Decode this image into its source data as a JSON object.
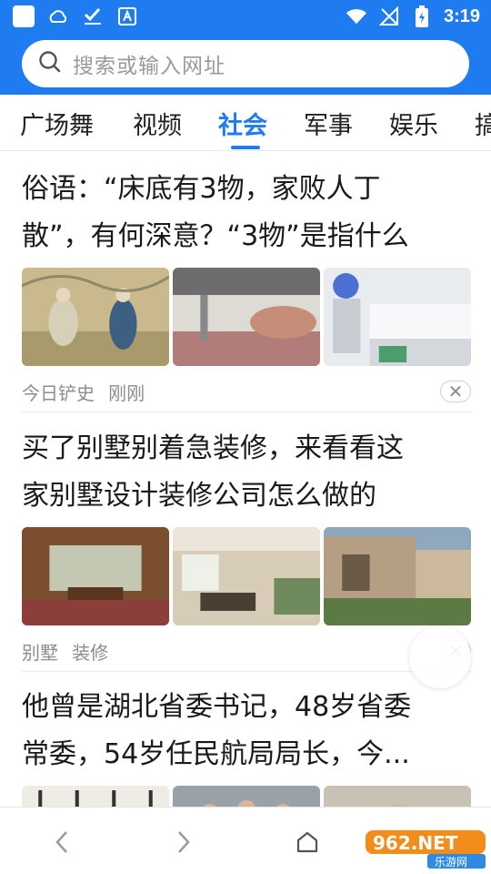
{
  "status_bar": {
    "time": "3:19"
  },
  "search": {
    "placeholder": "搜索或输入网址"
  },
  "tabs": [
    "广场舞",
    "视频",
    "社会",
    "军事",
    "娱乐",
    "搞"
  ],
  "active_tab": "社会",
  "articles": [
    {
      "title_line1": "俗语：“床底有3物，家败人丁",
      "title_line2": "散”，有何深意？“3物”是指什么",
      "source": "今日铲史",
      "time": "刚刚"
    },
    {
      "title_line1": "买了别墅别着急装修，来看看这",
      "title_line2": "家别墅设计装修公司怎么做的",
      "source": "别墅",
      "time": "装修"
    },
    {
      "title_line1": "他曾是湖北省委书记，48岁省委",
      "title_line2": "常委，54岁任民航局局长，今..."
    }
  ],
  "watermark": {
    "logo": "962.NET",
    "sub": "乐游网"
  },
  "colors": {
    "brand": "#1e7bf0",
    "meta_text": "#8c8c8c"
  }
}
